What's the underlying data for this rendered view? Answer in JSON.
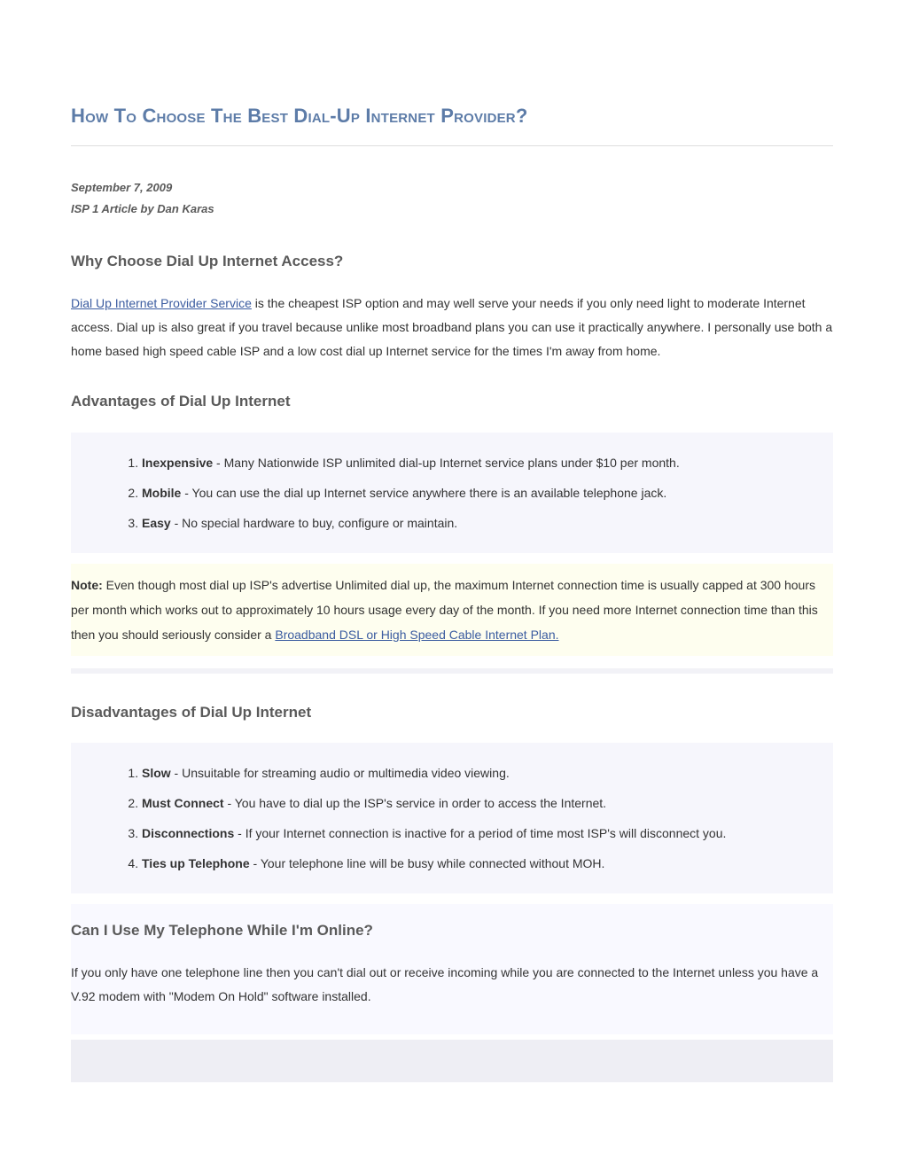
{
  "title": "How To Choose The Best Dial-Up Internet Provider?",
  "meta": {
    "date": "September 7, 2009",
    "byline": "ISP 1 Article by Dan Karas"
  },
  "sections": {
    "why": {
      "heading": "Why Choose Dial Up Internet Access?",
      "link_text": "Dial Up Internet Provider Service",
      "body_after_link": " is the cheapest ISP option and may well serve your needs if you only need light to moderate Internet access. Dial up is also great if you travel because unlike most broadband plans you can use it practically anywhere. I personally use both a home based high speed cable ISP and a low cost dial up Internet service for the times I'm away from home."
    },
    "advantages": {
      "heading": "Advantages of Dial Up Internet",
      "items": [
        {
          "label": "Inexpensive",
          "text": " - Many Nationwide ISP unlimited dial-up Internet service plans under $10 per month."
        },
        {
          "label": "Mobile",
          "text": " - You can use the dial up Internet service anywhere there is an available telephone jack."
        },
        {
          "label": "Easy",
          "text": " - No special hardware to buy, configure or maintain."
        }
      ]
    },
    "note": {
      "label": "Note:",
      "body_before_link": " Even though most dial up ISP's advertise Unlimited dial up, the maximum Internet connection time is usually capped at 300 hours per month which works out to approximately 10 hours usage every day of the month. If you need more Internet connection time than this then you should seriously consider a ",
      "link_text": "Broadband DSL or High Speed Cable Internet Plan."
    },
    "disadvantages": {
      "heading": "Disadvantages of Dial Up Internet",
      "items": [
        {
          "label": "Slow",
          "text": " - Unsuitable for streaming audio or multimedia video viewing."
        },
        {
          "label": "Must Connect",
          "text": " - You have to dial up the ISP's service in order to access the Internet."
        },
        {
          "label": "Disconnections",
          "text": " - If your Internet connection is inactive for a period of time most ISP's will disconnect you."
        },
        {
          "label": "Ties up Telephone",
          "text": " - Your telephone line will be busy while connected without MOH."
        }
      ]
    },
    "telephone": {
      "heading": "Can I Use My Telephone While I'm Online?",
      "body": "If you only have one telephone line then you can't dial out or receive incoming while you are connected to the Internet unless you have a V.92 modem with \"Modem On Hold\" software installed."
    }
  }
}
